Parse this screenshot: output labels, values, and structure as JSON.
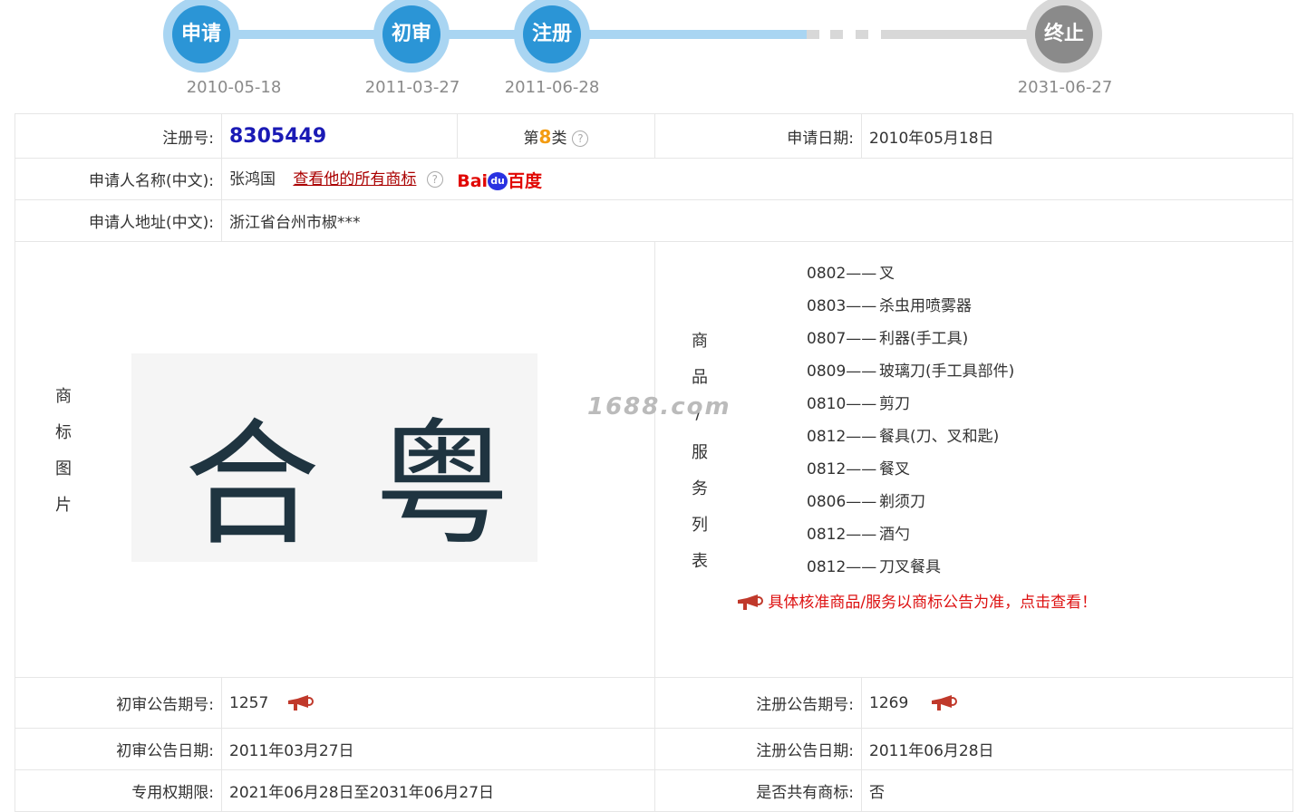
{
  "timeline": {
    "steps": [
      {
        "label": "申请",
        "date": "2010-05-18"
      },
      {
        "label": "初审",
        "date": "2011-03-27"
      },
      {
        "label": "注册",
        "date": "2011-06-28"
      },
      {
        "label": "终止",
        "date": "2031-06-27"
      }
    ]
  },
  "info": {
    "reg_no_label": "注册号:",
    "reg_no": "8305449",
    "class_prefix": "第",
    "class_num": "8",
    "class_suffix": "类",
    "apply_date_label": "申请日期:",
    "apply_date": "2010年05月18日",
    "applicant_name_label": "申请人名称(中文):",
    "applicant_name": "张鸿国",
    "view_all_link": "查看他的所有商标",
    "baidu_text_1": "Bai",
    "baidu_paw": "du",
    "baidu_text_2": "百度",
    "applicant_addr_label": "申请人地址(中文):",
    "applicant_addr": "浙江省台州市椒***",
    "mark_image_label": "商标图片",
    "mark_text_1": "合",
    "mark_text_2": "粤",
    "goods_label": "商品/服务列表",
    "goods": [
      {
        "code": "0802——",
        "name": "叉"
      },
      {
        "code": "0803——",
        "name": "杀虫用喷雾器"
      },
      {
        "code": "0807——",
        "name": "利器(手工具)"
      },
      {
        "code": "0809——",
        "name": "玻璃刀(手工具部件)"
      },
      {
        "code": "0810——",
        "name": "剪刀"
      },
      {
        "code": "0812——",
        "name": "餐具(刀、叉和匙)"
      },
      {
        "code": "0812——",
        "name": "餐叉"
      },
      {
        "code": "0806——",
        "name": "剃须刀"
      },
      {
        "code": "0812——",
        "name": "酒勺"
      },
      {
        "code": "0812——",
        "name": "刀叉餐具"
      }
    ],
    "notice": "具体核准商品/服务以商标公告为准，点击查看！",
    "watermark": "1688.com",
    "prelim_no_label": "初审公告期号:",
    "prelim_no": "1257",
    "reg_pub_no_label": "注册公告期号:",
    "reg_pub_no": "1269",
    "prelim_date_label": "初审公告日期:",
    "prelim_date": "2011年03月27日",
    "reg_pub_date_label": "注册公告日期:",
    "reg_pub_date": "2011年06月28日",
    "exclusive_label": "专用权期限:",
    "exclusive": "2021年06月28日至2031年06月27日",
    "shared_label": "是否共有商标:",
    "shared": "否"
  }
}
